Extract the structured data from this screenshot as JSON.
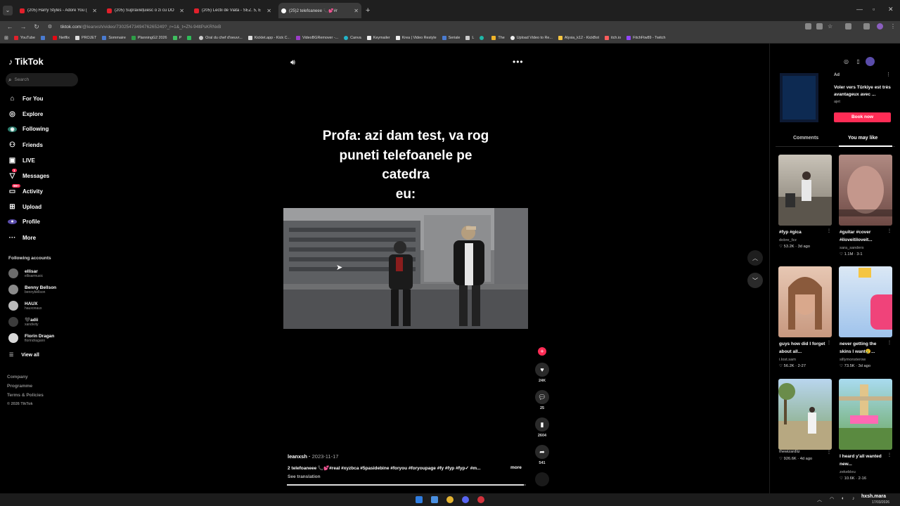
{
  "browser": {
    "tabs": [
      {
        "label": "(205) Harry Styles - Adore You (",
        "favicon": "youtube"
      },
      {
        "label": "(205) Supraviețuiesc o zi cu DO",
        "favicon": "youtube"
      },
      {
        "label": "(205) Lectii de Viata - SEZ. 5, E",
        "favicon": "youtube"
      },
      {
        "label": "(25)2 telefoaneee 📞💕#r",
        "favicon": "tiktok"
      }
    ],
    "url_host": "tiktok.com",
    "url_path": "/@leanxsh/video/7302547349476265249?_r=1&_t=ZN-94ltPsKRNxB",
    "bookmarks": [
      "YouTube",
      "Netflix",
      "PROJET",
      "Sommaire",
      "PlanningG2 2026",
      "P",
      "Oral du chef d'oeuvr...",
      "Kicklet.app - Kick C...",
      "VideoBGRemover -...",
      "Canva",
      "Keymailer",
      "Krea | Video Restyle",
      "Seriale",
      "L",
      "The",
      "Upload Video to Re...",
      "Alysia_k12 - KickBot",
      "itch.io",
      "FitchFtw89 - Twitch"
    ]
  },
  "sidebar": {
    "logo": "TikTok",
    "search_placeholder": "Search",
    "nav": [
      "For You",
      "Explore",
      "Following",
      "Friends",
      "LIVE",
      "Messages",
      "Activity",
      "Upload",
      "Profile",
      "More"
    ],
    "activity_badge": "99+",
    "messages_badge": "1",
    "following_title": "Following accounts",
    "accounts": [
      {
        "name": "ellisar",
        "handle": "ellisarmusic"
      },
      {
        "name": "Benny Bellson",
        "handle": "bennybellson"
      },
      {
        "name": "HAUX",
        "handle": "hauxonaux"
      },
      {
        "name": "🖤adii",
        "handle": "xandivity"
      },
      {
        "name": "Florin Dragan",
        "handle": "florindragann"
      }
    ],
    "view_all": "View all",
    "footer": [
      "Company",
      "Programme",
      "Terms & Policies"
    ],
    "copyright": "© 2026 TikTok"
  },
  "video": {
    "caption_lines": [
      "Profa: azi dam test, va rog",
      "puneti telefoanele pe",
      "catedra",
      "eu:"
    ],
    "author": "leanxsh",
    "date": "2023-11-17",
    "description": "2 telefoaneee 📞💕#real #xyzbca #5pasidebine #foryou #foryoupage #fy #fyp #fyp✓ #m...",
    "more": "more",
    "see_translation": "See translation",
    "progress": 0.99,
    "likes": "24K",
    "comments": "25",
    "saves": "2604",
    "shares": "541"
  },
  "rightpanel": {
    "ad_label": "Ad",
    "ad_text": "Voler vers Türkiye est très avantageux avec ...",
    "ad_brand": "ajet",
    "ad_button": "Book now",
    "tab_comments": "Comments",
    "tab_you_may_like": "You may like",
    "suggestions": [
      {
        "title": "#fyp #gica",
        "author": "dobre_fzz",
        "stats": "♡ 53.2K · 3d ago"
      },
      {
        "title": "#guitar #cover #iloveitiloveit...",
        "author": "sara_sanders",
        "stats": "♡ 1.1M · 3-1"
      },
      {
        "title": "guys how did I forget about all...",
        "author": "i.lost.sam",
        "stats": "♡ 56.2K · 2-27"
      },
      {
        "title": "never getting the skins I want😢...",
        "author": "sillymonsterow",
        "stats": "♡ 73.5K · 3d ago"
      },
      {
        "title": "",
        "author": "thewizardliz",
        "stats": "♡ 926.6K · 4d ago"
      },
      {
        "title": "I heard y'all wanted new...",
        "author": "zekebleu",
        "stats": "♡ 10.6K · 2-16"
      }
    ]
  },
  "taskbar": {
    "user": "hxsh.mara",
    "date": "17/03/2026"
  }
}
